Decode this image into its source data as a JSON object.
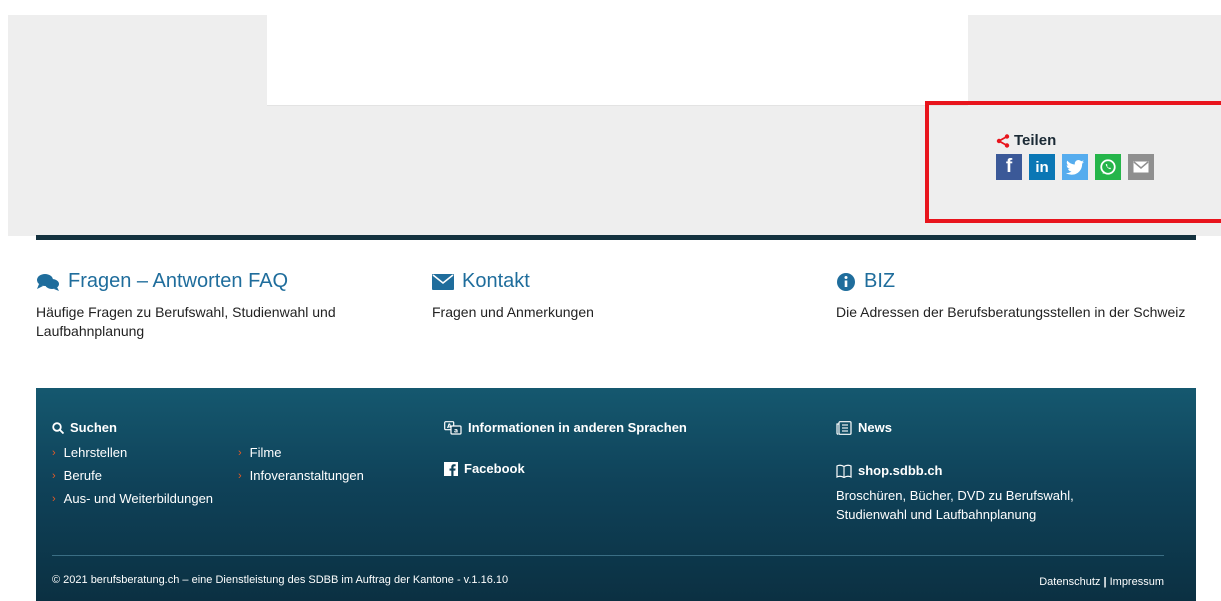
{
  "share": {
    "label": "Teilen",
    "buttons": [
      {
        "name": "facebook",
        "glyph": "f",
        "color": "#3b5998"
      },
      {
        "name": "linkedin",
        "glyph": "in",
        "color": "#0a77b5"
      },
      {
        "name": "twitter",
        "glyph": "",
        "color": "#55acee"
      },
      {
        "name": "whatsapp",
        "glyph": "",
        "color": "#25b54a"
      },
      {
        "name": "email",
        "glyph": "",
        "color": "#8f8f8f"
      }
    ]
  },
  "faq": [
    {
      "title": "Fragen – Antworten FAQ",
      "desc": "Häufige Fragen zu Berufswahl, Studienwahl und Laufbahnplanung"
    },
    {
      "title": "Kontakt",
      "desc": "Fragen und Anmerkungen"
    },
    {
      "title": "BIZ",
      "desc": "Die Adressen der Berufsberatungsstellen in der Schweiz"
    }
  ],
  "footer": {
    "search": {
      "heading": "Suchen",
      "links": [
        "Lehrstellen",
        "Filme",
        "Berufe",
        "Infoveranstaltungen",
        "Aus- und Weiterbildungen"
      ]
    },
    "languages": "Informationen in anderen Sprachen",
    "facebook": "Facebook",
    "news": "News",
    "shop": {
      "heading": "shop.sdbb.ch",
      "desc": "Broschüren, Bücher, DVD zu Berufswahl, Studienwahl und Laufbahnplanung"
    },
    "copyright": "© 2021 berufsberatung.ch – eine Dienstleistung des SDBB im Auftrag der Kantone - v.1.16.10",
    "legal": {
      "privacy": "Datenschutz",
      "separator": "|",
      "imprint": "Impressum"
    }
  },
  "colors": {
    "accent": "#1f6d9c",
    "footer_bg": "#0f4259",
    "highlight": "#e8141c",
    "chevron": "#e85a24"
  }
}
